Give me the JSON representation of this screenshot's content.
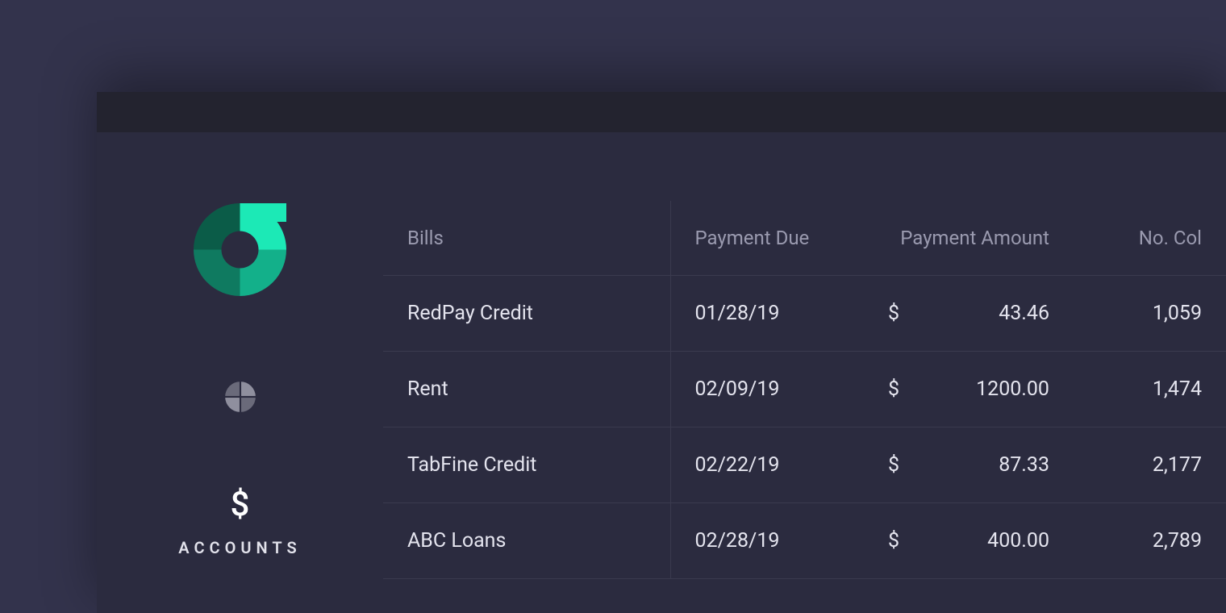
{
  "colors": {
    "logo_light": "#1ce9b6",
    "logo_dark": "#159b7a",
    "text_muted": "#9a9aaf",
    "text_primary": "#e4e4ee"
  },
  "sidebar": {
    "nav": {
      "accounts_label": "ACCOUNTS"
    }
  },
  "table": {
    "headers": {
      "bills": "Bills",
      "payment_due": "Payment Due",
      "payment_amount": "Payment Amount",
      "no_col": "No. Col"
    },
    "currency_symbol": "$",
    "rows": [
      {
        "bills": "RedPay Credit",
        "due": "01/28/19",
        "amount": "43.46",
        "no_col": "1,059"
      },
      {
        "bills": "Rent",
        "due": "02/09/19",
        "amount": "1200.00",
        "no_col": "1,474"
      },
      {
        "bills": "TabFine Credit",
        "due": "02/22/19",
        "amount": "87.33",
        "no_col": "2,177"
      },
      {
        "bills": "ABC Loans",
        "due": "02/28/19",
        "amount": "400.00",
        "no_col": "2,789"
      }
    ]
  }
}
